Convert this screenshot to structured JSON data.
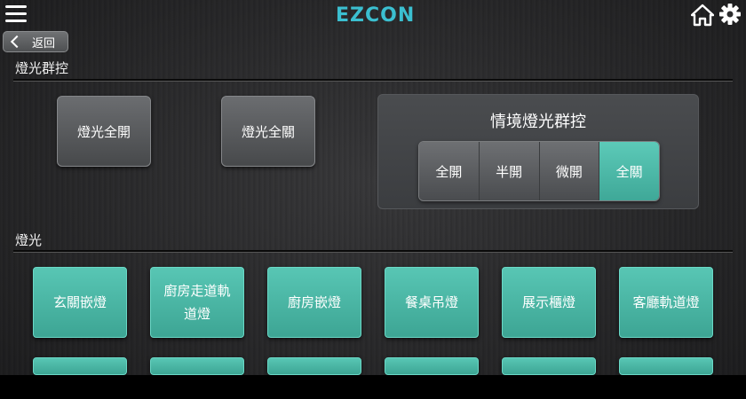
{
  "header": {
    "menu_icon": "hamburger-menu-icon",
    "logo_text": "EZCON",
    "logo_color": "#3bbfd0",
    "home_icon": "home-icon",
    "settings_icon": "gear-icon"
  },
  "back": {
    "label": "返回"
  },
  "group_section": {
    "title": "燈光群控",
    "buttons": [
      "燈光全開",
      "燈光全關"
    ]
  },
  "scene": {
    "title": "情境燈光群控",
    "options": [
      "全開",
      "半開",
      "微開",
      "全關"
    ],
    "active": "全關"
  },
  "lights_section": {
    "title": "燈光",
    "row1": [
      "玄關嵌燈",
      "廚房走道軌道燈",
      "廚房嵌燈",
      "餐桌吊燈",
      "展示櫃燈",
      "客廳軌道燈"
    ]
  },
  "colors": {
    "teal": "#4dbba9",
    "background": "#2c2c2e",
    "gray_button": "#5a5c5f"
  }
}
